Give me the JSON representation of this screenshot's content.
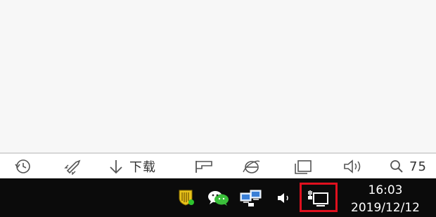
{
  "statusbar": {
    "items": [
      {
        "icon": "back-arrow-circle-icon"
      },
      {
        "icon": "rocket-icon"
      },
      {
        "icon": "download-arrow-icon",
        "label": "下载"
      },
      {
        "icon": "flag-icon"
      },
      {
        "icon": "ie-browser-icon"
      },
      {
        "icon": "window-icon"
      },
      {
        "icon": "speaker-icon"
      },
      {
        "icon": "zoom-icon",
        "label": "75"
      }
    ]
  },
  "taskbar": {
    "tray_icons": [
      "security-shield-icon",
      "wechat-icon",
      "network-computers-icon",
      "volume-icon",
      "network-connection-icon"
    ],
    "highlight_color": "#e0101e",
    "clock": {
      "time": "16:03",
      "date": "2019/12/12"
    }
  }
}
